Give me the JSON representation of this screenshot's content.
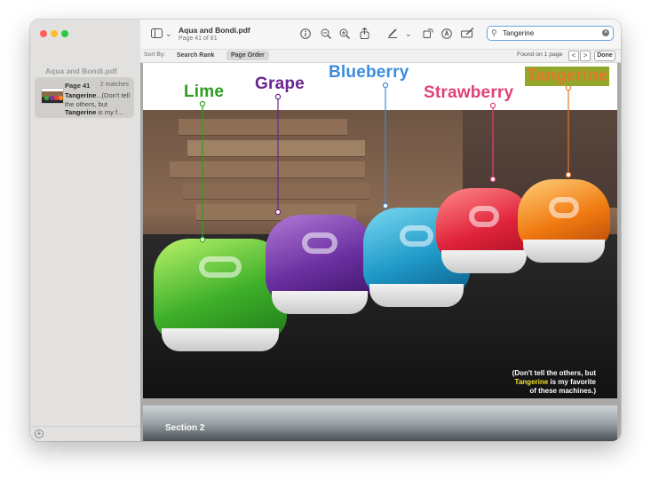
{
  "window": {
    "sidebar_doc_title": "Aqua and Bondi.pdf"
  },
  "toolbar": {
    "doc_title": "Aqua and Bondi.pdf",
    "doc_subtitle": "Page 41 of 81",
    "search_value": "Tangerine",
    "icons": [
      "sidebar-icon",
      "chevron-down-icon",
      "info-icon",
      "zoom-out-icon",
      "zoom-in-icon",
      "share-icon",
      "markup-pen-icon",
      "chevron-down-icon",
      "rotate-icon",
      "annotate-icon",
      "form-icon",
      "search-icon",
      "clear-icon"
    ]
  },
  "findbar": {
    "sort_by": "Sort By:",
    "search_rank": "Search Rank",
    "page_order": "Page Order",
    "found": "Found on 1 page",
    "prev": "<",
    "next": ">",
    "done": "Done"
  },
  "sidebar": {
    "result": {
      "page": "Page 41",
      "count": "2 matches",
      "snippet_1": "Tangerine",
      "snippet_2": "...(Don't tell the others, but ",
      "snippet_3": "Tangerine",
      "snippet_4": " is my f..."
    }
  },
  "page": {
    "labels": {
      "lime": "Lime",
      "grape": "Grape",
      "blueberry": "Blueberry",
      "strawberry": "Strawberry",
      "tangerine": "Tangerine"
    },
    "colors": {
      "lime": "#2e9e1f",
      "grape": "#6a2490",
      "blueberry": "#3a8de0",
      "strawberry": "#e23f79",
      "tangerine": "#e0792b"
    },
    "caption": {
      "line1": "(Don't tell the others, but",
      "highlight": "Tangerine",
      "line2_rest": " is my favorite",
      "line3": "of these machines.)"
    },
    "next_section": "Section 2"
  }
}
